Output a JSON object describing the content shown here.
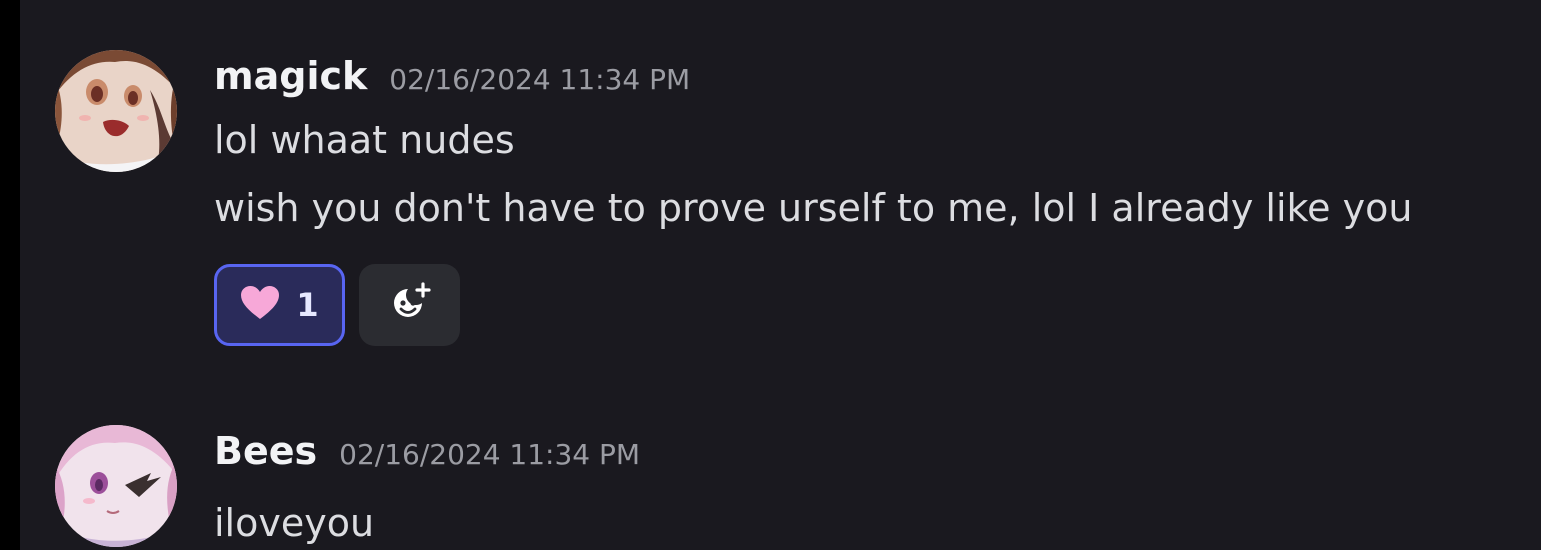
{
  "messages": [
    {
      "username": "magick",
      "timestamp": "02/16/2024 11:34 PM",
      "lines": [
        "lol whaat nudes",
        "wish you don't have to prove urself to me, lol I already like you"
      ],
      "reaction": {
        "emoji_icon": "pink-heart-icon",
        "count": "1"
      },
      "add_reaction_icon": "add-reaction-icon"
    },
    {
      "username": "Bees",
      "timestamp": "02/16/2024 11:34 PM",
      "lines": [
        "iloveyou"
      ]
    }
  ],
  "colors": {
    "background": "#1a191f",
    "username": "#f2f3f5",
    "timestamp": "#9b9ca3",
    "message_text": "#dcdde1",
    "reaction_bg": "#2a2b5a",
    "reaction_border": "#5865f2",
    "heart": "#f7a8d8"
  }
}
